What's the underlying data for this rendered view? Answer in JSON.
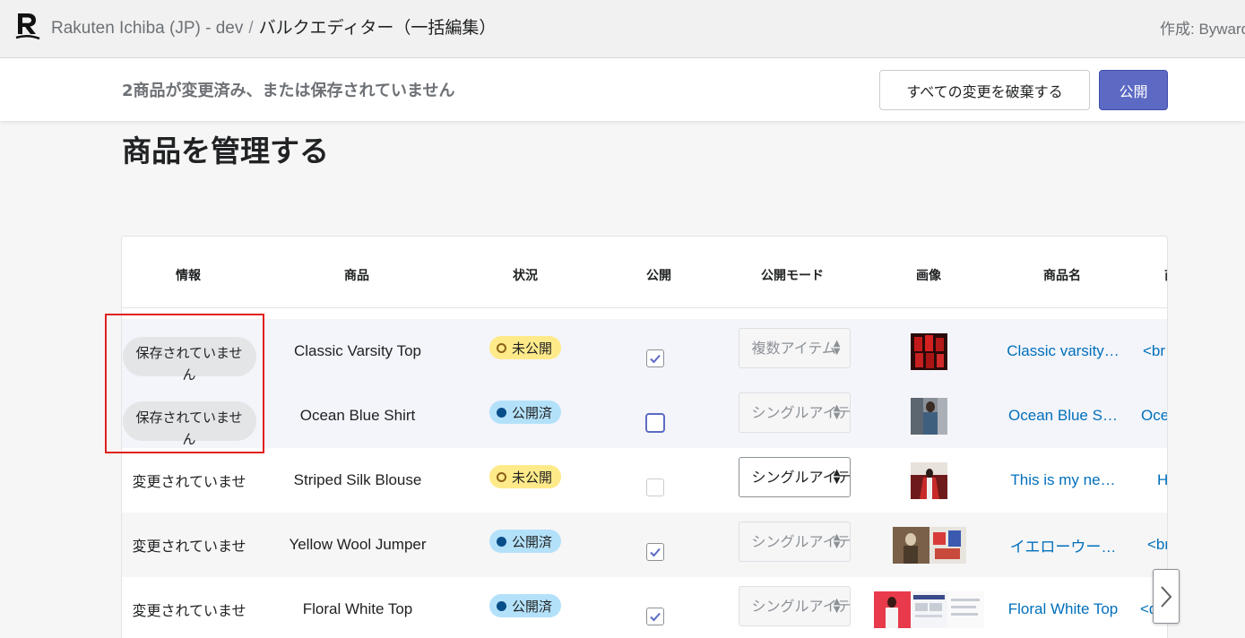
{
  "header": {
    "store": "Rakuten Ichiba (JP) - dev",
    "separator": "/",
    "page": "バルクエディター（一括編集）",
    "author": "作成: Byward"
  },
  "savebar": {
    "message": "2商品が変更済み、または保存されていません",
    "discard_label": "すべての変更を破棄する",
    "publish_label": "公開"
  },
  "page_title": "商品を管理する",
  "columns": [
    "情報",
    "商品",
    "状況",
    "公開",
    "公開モード",
    "画像",
    "商品名",
    "商"
  ],
  "rows": [
    {
      "info": "保存されていません",
      "product": "Classic Varsity Top",
      "status": "未公開",
      "published": true,
      "mode": "複数アイテム",
      "name": "Classic varsity…",
      "desc": "<br"
    },
    {
      "info": "保存されていません",
      "product": "Ocean Blue Shirt",
      "status": "公開済",
      "published": false,
      "mode": "シングルアイテム",
      "name": "Ocean Blue S…",
      "desc": "Oce"
    },
    {
      "info": "変更されていませ",
      "product": "Striped Silk Blouse",
      "status": "未公開",
      "published": false,
      "mode": "シングルアイテム",
      "name": "This is my ne…",
      "desc": "H"
    },
    {
      "info": "変更されていませ",
      "product": "Yellow Wool Jumper",
      "status": "公開済",
      "published": true,
      "mode": "シングルアイテム",
      "name": "イエローウー…",
      "desc": "<br"
    },
    {
      "info": "変更されていませ",
      "product": "Floral White Top",
      "status": "公開済",
      "published": true,
      "mode": "シングルアイテム",
      "name": "Floral White Top",
      "desc": "<d"
    }
  ],
  "colors": {
    "accent": "#5c6ac4",
    "link": "#006fbb",
    "draft_badge": "#ffea8a",
    "live_badge": "#b4e1fa",
    "highlight_box": "#e02020"
  }
}
